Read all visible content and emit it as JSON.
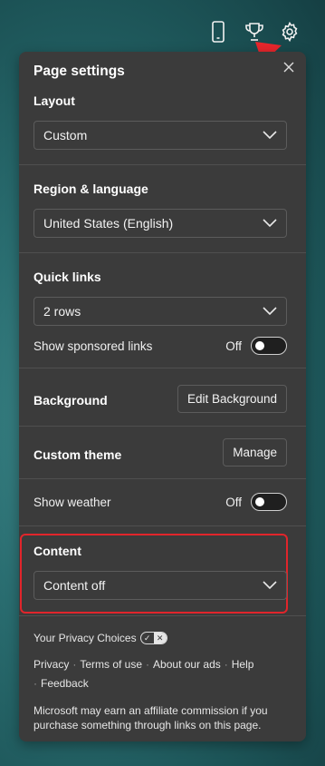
{
  "topbar": {
    "icons": [
      "phone-icon",
      "trophy-icon",
      "settings-gear-icon"
    ]
  },
  "panel": {
    "title": "Page settings",
    "close_icon": "close-icon",
    "layout": {
      "label": "Layout",
      "value": "Custom"
    },
    "region": {
      "label": "Region & language",
      "value": "United States (English)"
    },
    "quick_links": {
      "label": "Quick links",
      "value": "2 rows",
      "sponsored_label": "Show sponsored links",
      "sponsored_state": "Off"
    },
    "background": {
      "label": "Background",
      "button": "Edit Background"
    },
    "custom_theme": {
      "label": "Custom theme",
      "button": "Manage"
    },
    "weather": {
      "label": "Show weather",
      "state": "Off"
    },
    "content": {
      "label": "Content",
      "value": "Content off"
    },
    "footer": {
      "privacy_choices": "Your Privacy Choices",
      "links": [
        "Privacy",
        "Terms of use",
        "About our ads",
        "Help",
        "Feedback"
      ],
      "disclaimer_line1": "Microsoft may earn an affiliate commission if you",
      "disclaimer_line2": "purchase something through links on this page."
    }
  },
  "colors": {
    "panel_bg": "#3b3b3b",
    "highlight_red": "#e1252b",
    "arrow_red": "#e8262c"
  }
}
